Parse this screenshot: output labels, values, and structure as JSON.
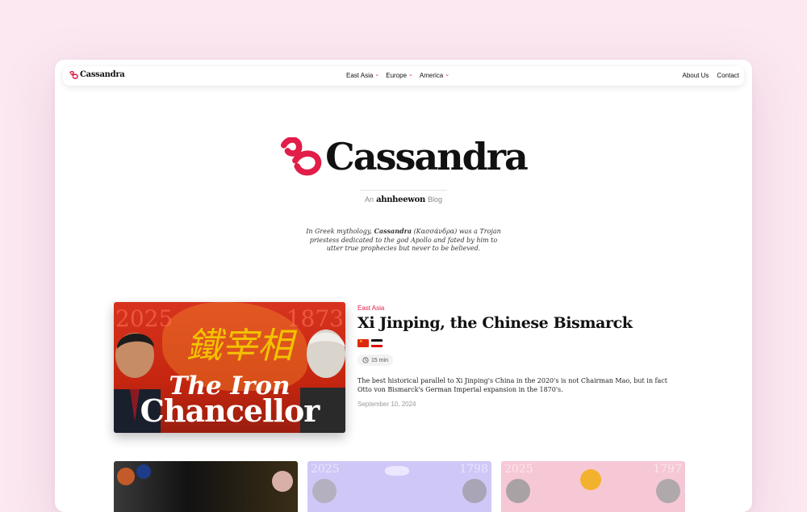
{
  "nav": {
    "brand": "Cassandra",
    "menu": [
      {
        "label": "East Asia",
        "icon": "chevron-down-icon"
      },
      {
        "label": "Europe",
        "icon": "chevron-down-icon"
      },
      {
        "label": "America",
        "icon": "chevron-down-icon"
      }
    ],
    "links": [
      "About Us",
      "Contact"
    ]
  },
  "hero": {
    "brand": "Cassandra",
    "sub_prefix": "An",
    "sub_author": "ahnheewon",
    "sub_suffix": "Blog",
    "desc_prefix": "In Greek mythology,",
    "desc_name": "Cassandra",
    "desc_rest": "(Κασσάνδρα) was a Trojan priestess dedicated to the god Apollo and fated by him to utter true prophecies but never to be believed."
  },
  "featured": {
    "image": {
      "year_left": "2025",
      "year_right": "1873",
      "calligraphy": "鐵宰相",
      "line1": "The Iron",
      "line2": "Chancellor"
    },
    "category": "East Asia",
    "title": "Xi Jinping, the Chinese Bismarck",
    "flags": [
      "china-flag",
      "german-empire-flag"
    ],
    "read_time": "15 min",
    "excerpt": "The best historical parallel to Xi Jinping's China in the 2020's is not Chairman Mao, but in fact Otto von Bismarck's German Imperial expansion in the 1870's.",
    "date": "September 10, 2024"
  },
  "cards": [
    {
      "year_left": "",
      "year_right": ""
    },
    {
      "year_left": "2025",
      "year_right": "1798"
    },
    {
      "year_left": "2025",
      "year_right": "1797"
    }
  ],
  "colors": {
    "accent": "#e11d48",
    "background": "#fbe8f1",
    "feature_red": "#c6260f"
  }
}
